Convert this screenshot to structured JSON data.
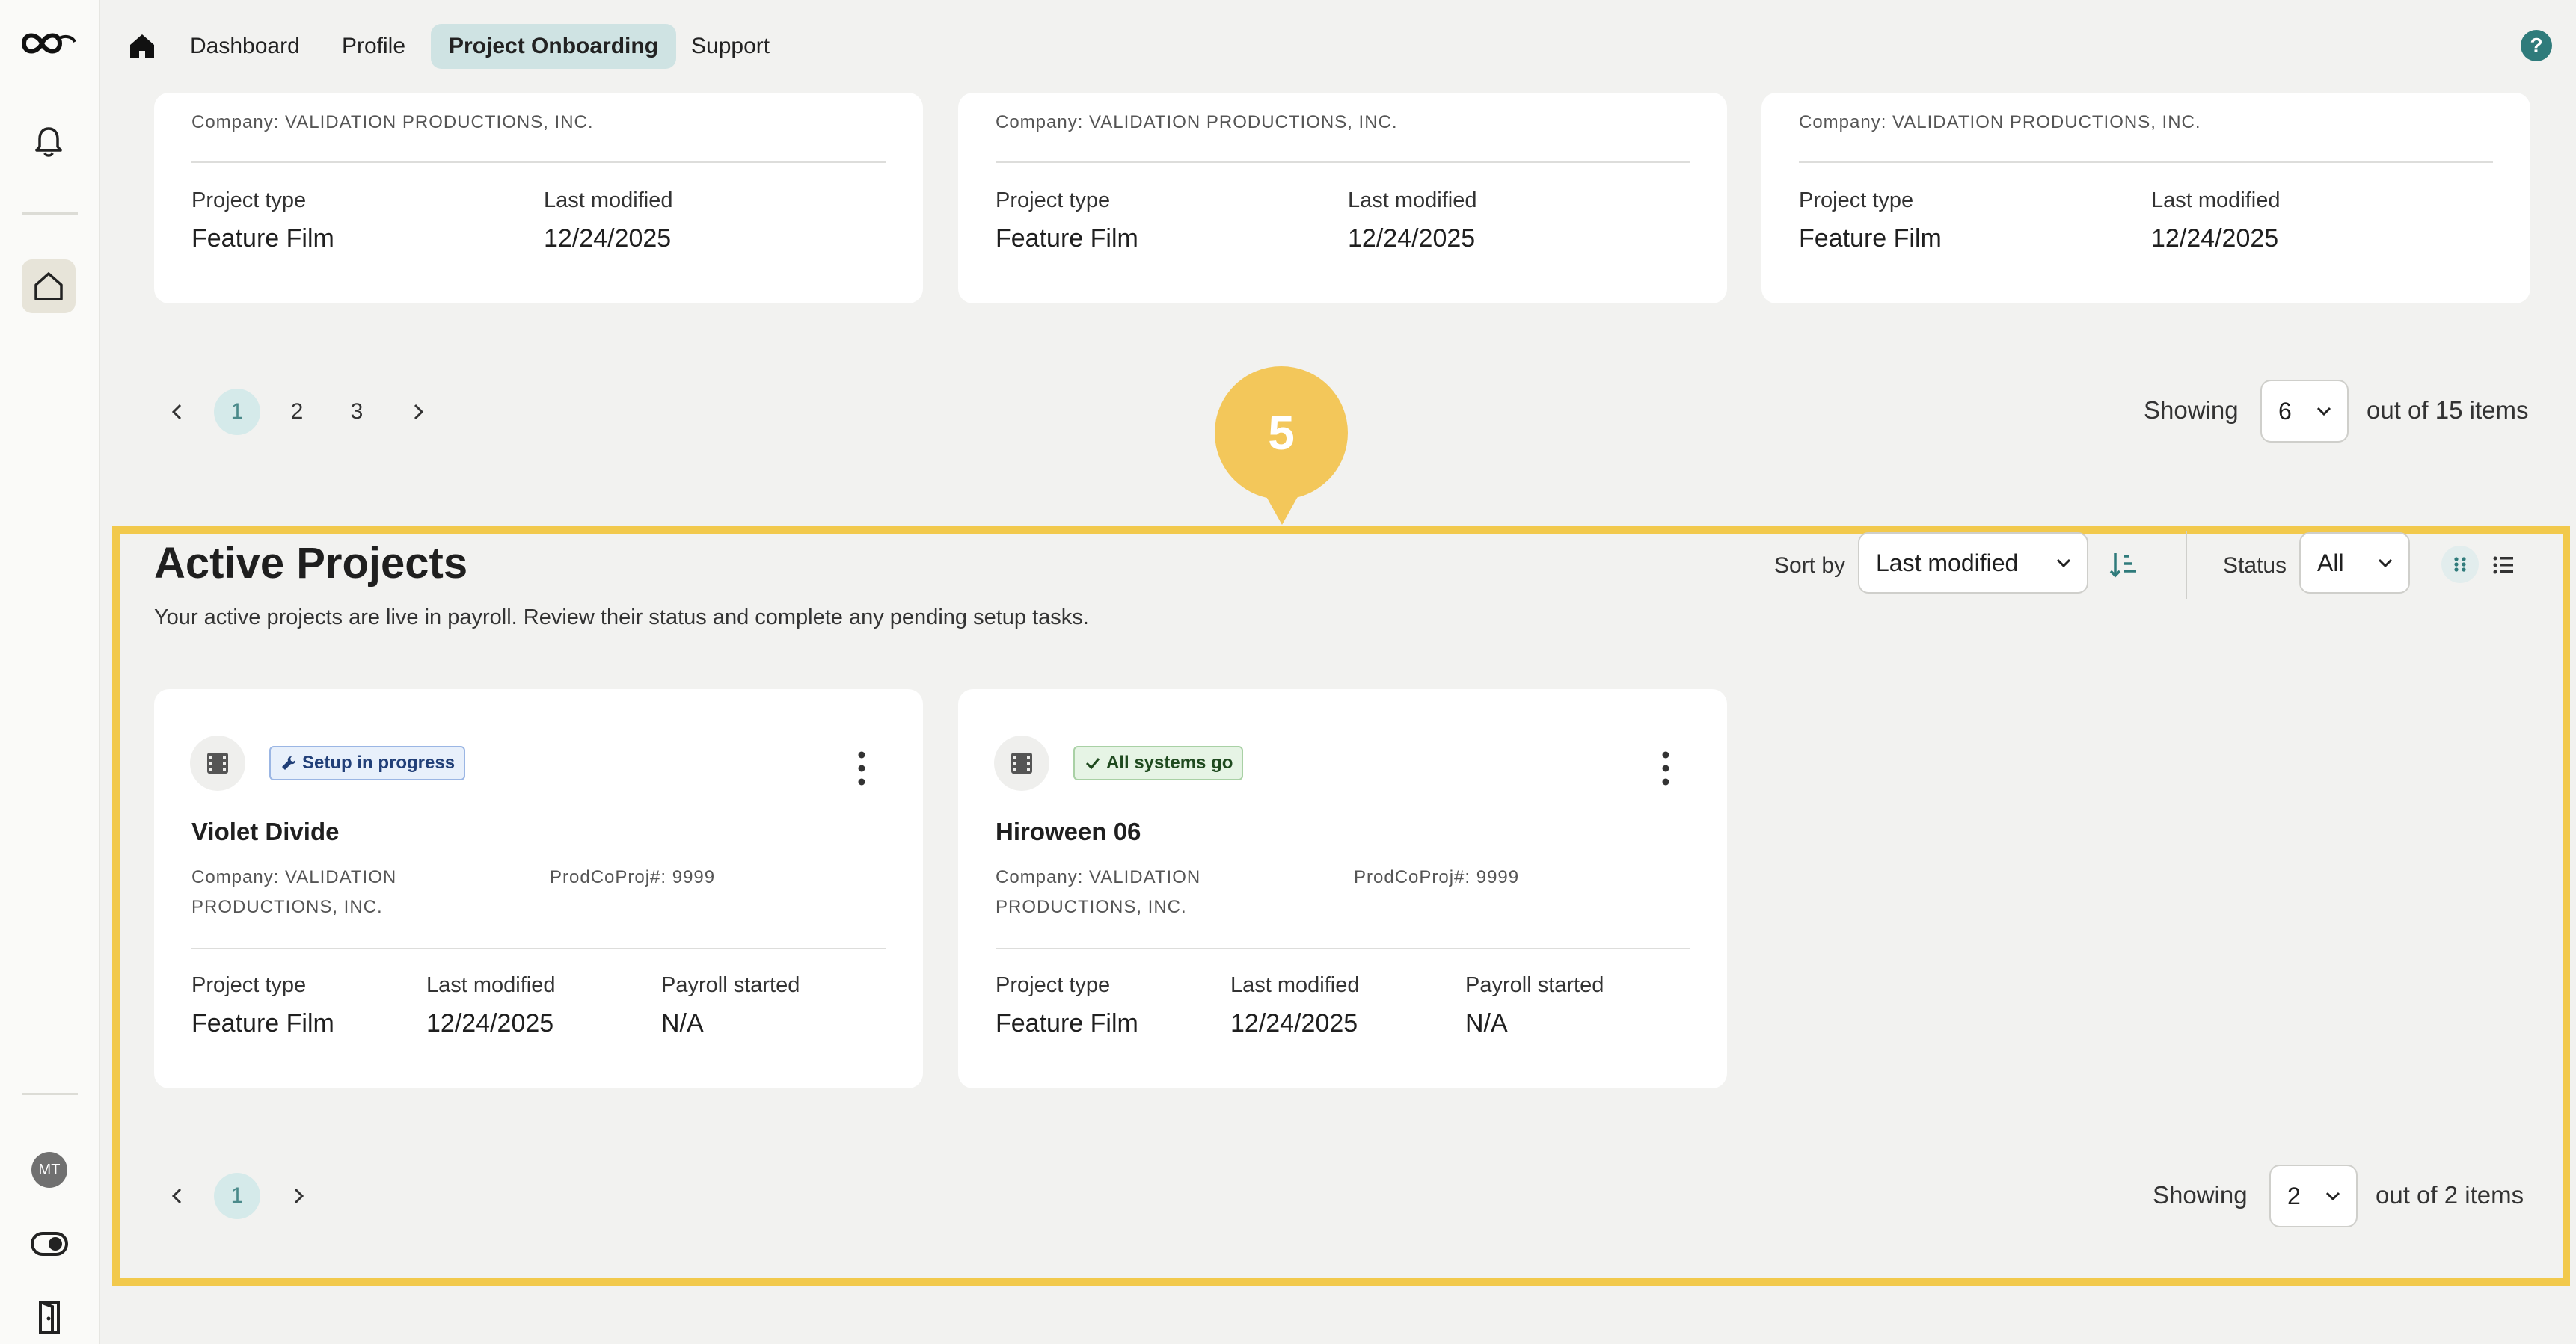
{
  "nav": {
    "items": [
      {
        "label": "Dashboard",
        "active": false
      },
      {
        "label": "Profile",
        "active": false
      },
      {
        "label": "Project Onboarding",
        "active": true
      },
      {
        "label": "Support",
        "active": false
      }
    ],
    "help": "?"
  },
  "rail": {
    "avatar": "MT"
  },
  "upper_cards": [
    {
      "company": "Company: VALIDATION PRODUCTIONS, INC.",
      "project_type_label": "Project type",
      "project_type": "Feature Film",
      "last_modified_label": "Last modified",
      "last_modified": "12/24/2025"
    },
    {
      "company": "Company: VALIDATION PRODUCTIONS, INC.",
      "project_type_label": "Project type",
      "project_type": "Feature Film",
      "last_modified_label": "Last modified",
      "last_modified": "12/24/2025"
    },
    {
      "company": "Company: VALIDATION PRODUCTIONS, INC.",
      "project_type_label": "Project type",
      "project_type": "Feature Film",
      "last_modified_label": "Last modified",
      "last_modified": "12/24/2025"
    }
  ],
  "upper_pager": {
    "pages": [
      "1",
      "2",
      "3"
    ],
    "active_page": "1",
    "showing_label": "Showing",
    "page_size": "6",
    "total_label": "out of 15 items"
  },
  "annotation": {
    "step": "5"
  },
  "active": {
    "title": "Active Projects",
    "subtitle": "Your active projects are live in payroll. Review their status and complete any pending setup tasks.",
    "sort_label": "Sort by",
    "sort_value": "Last modified",
    "status_label": "Status",
    "status_value": "All",
    "cards": [
      {
        "badge": "Setup in progress",
        "badge_kind": "setup",
        "name": "Violet Divide",
        "company_line1": "Company: VALIDATION",
        "company_line2": "PRODUCTIONS, INC.",
        "prodco": "ProdCoProj#: 9999",
        "project_type_label": "Project type",
        "project_type": "Feature Film",
        "last_modified_label": "Last modified",
        "last_modified": "12/24/2025",
        "payroll_label": "Payroll started",
        "payroll": "N/A"
      },
      {
        "badge": "All systems go",
        "badge_kind": "go",
        "name": "Hiroween 06",
        "company_line1": "Company: VALIDATION",
        "company_line2": "PRODUCTIONS, INC.",
        "prodco": "ProdCoProj#: 9999",
        "project_type_label": "Project type",
        "project_type": "Feature Film",
        "last_modified_label": "Last modified",
        "last_modified": "12/24/2025",
        "payroll_label": "Payroll started",
        "payroll": "N/A"
      }
    ],
    "pager": {
      "pages": [
        "1"
      ],
      "active_page": "1",
      "showing_label": "Showing",
      "page_size": "2",
      "total_label": "out of 2 items"
    }
  }
}
